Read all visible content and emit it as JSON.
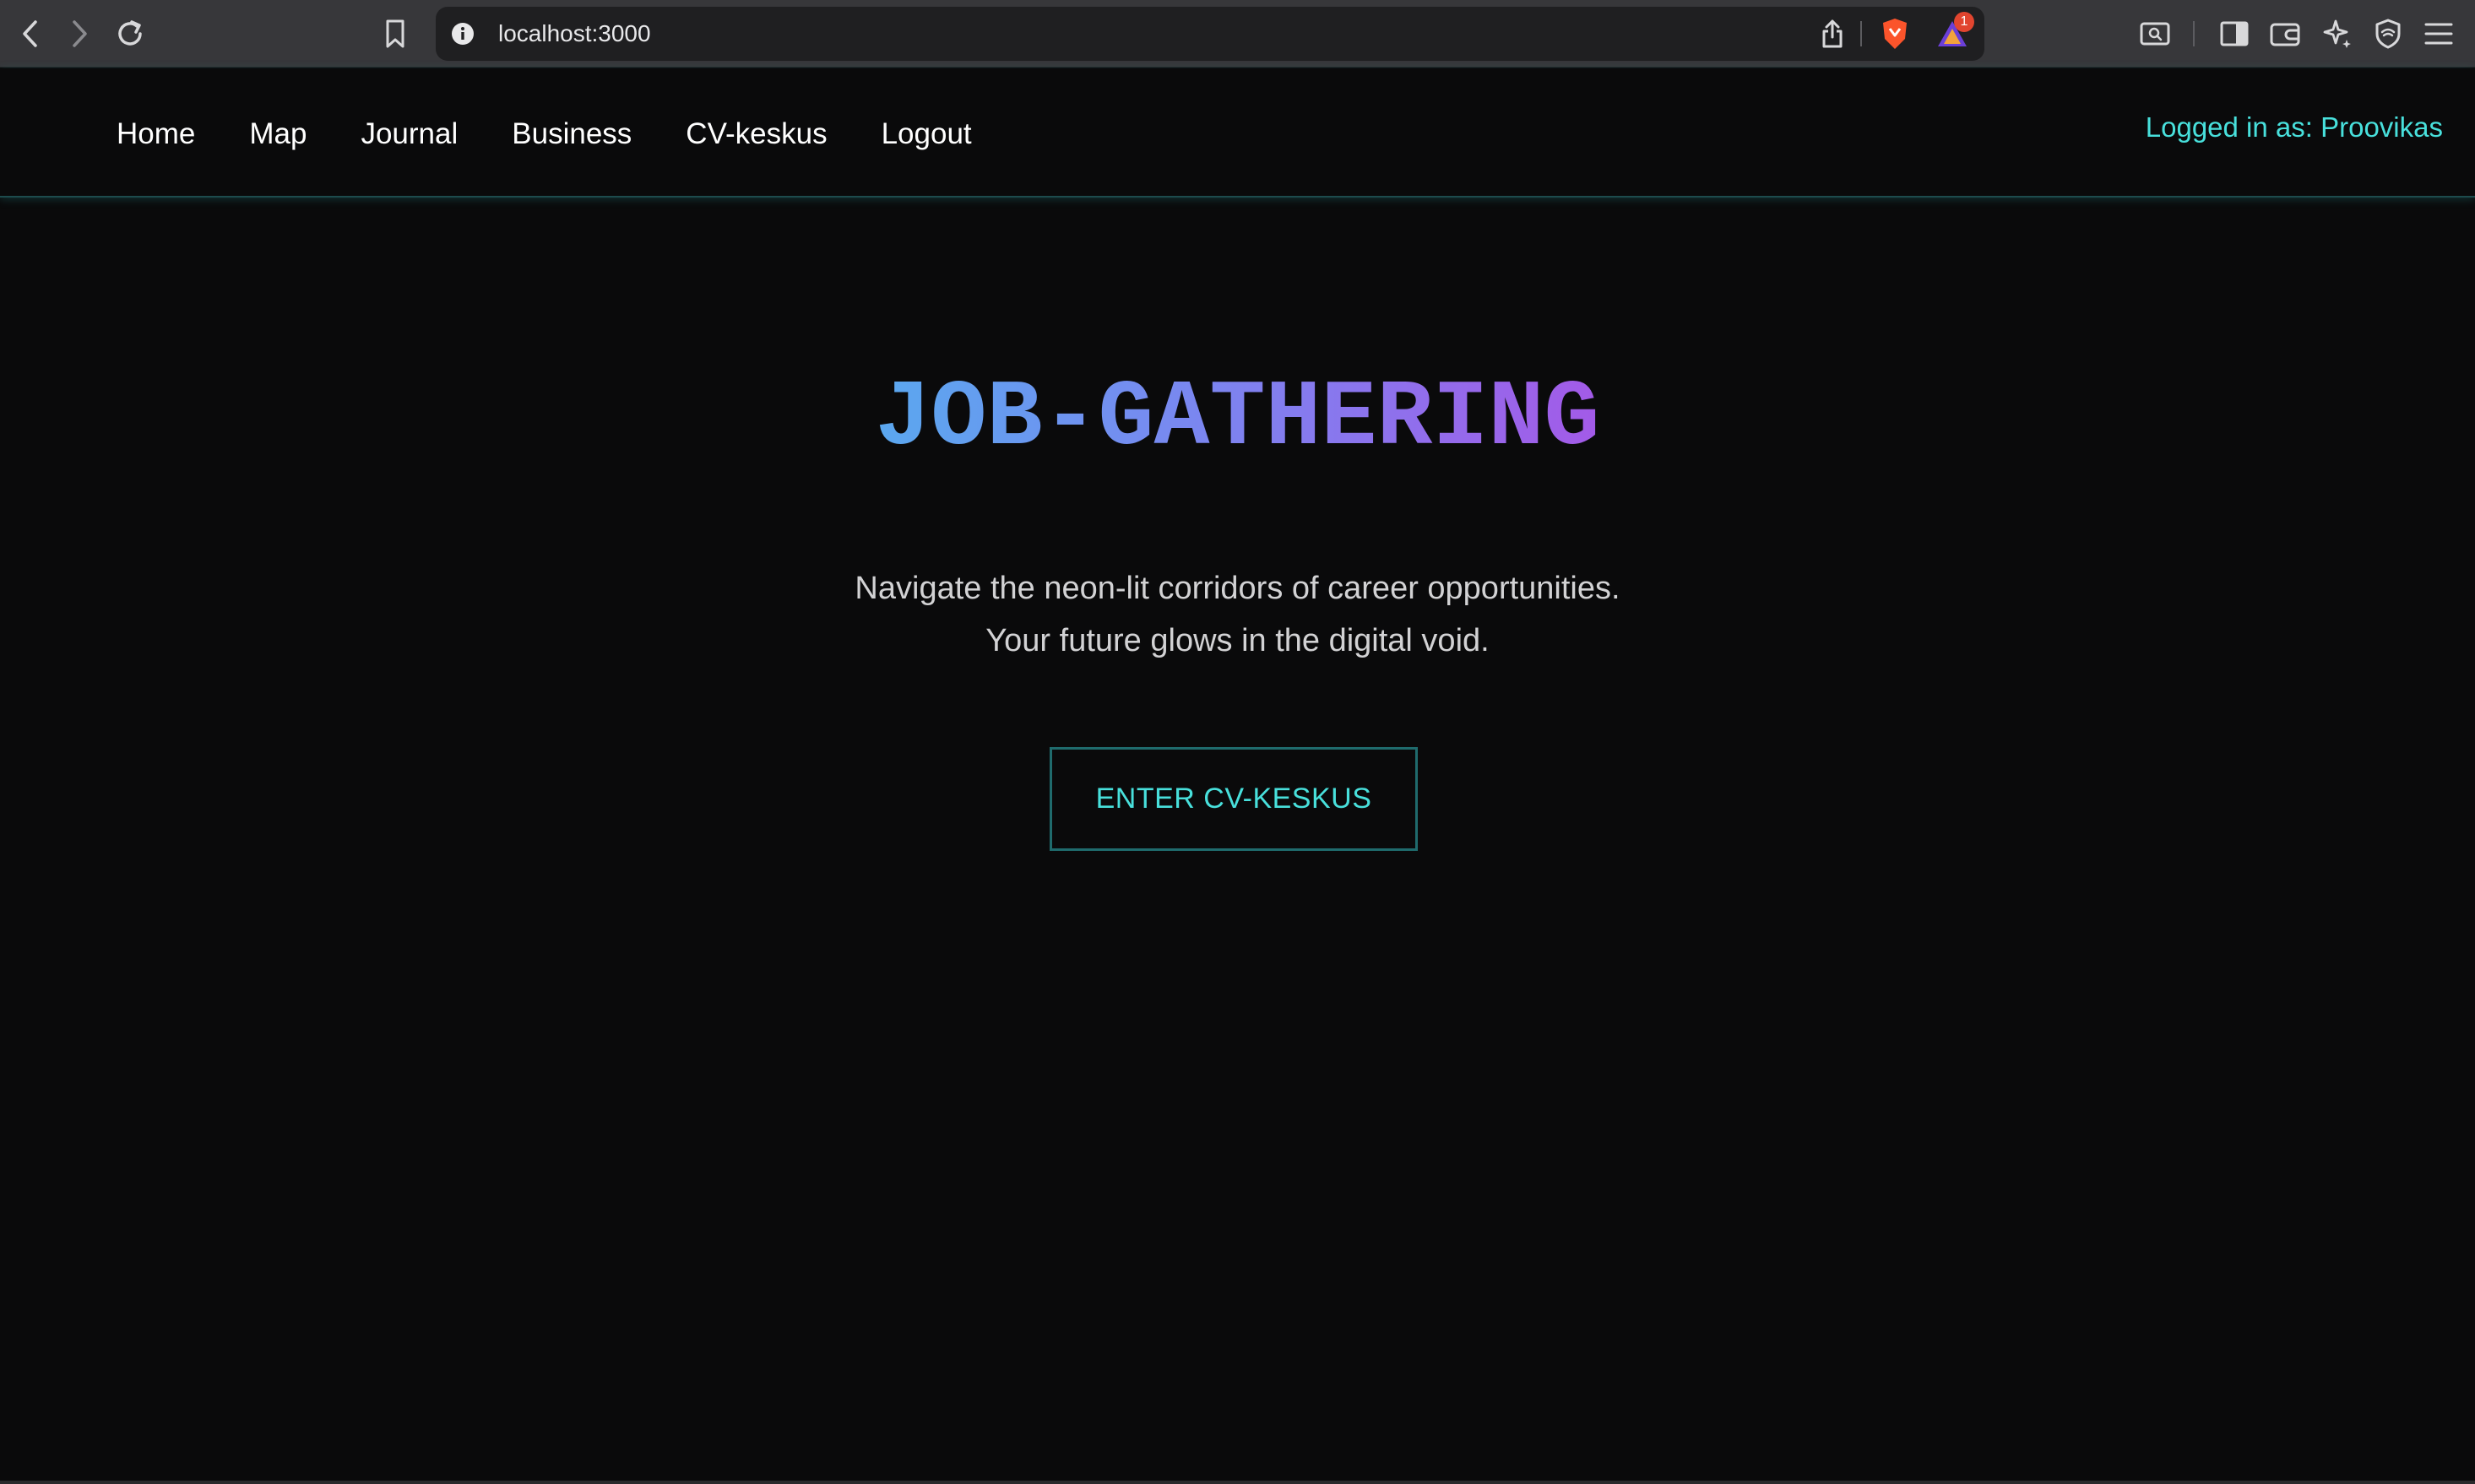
{
  "browser": {
    "url": "localhost:3000",
    "notification_count": "1",
    "icons": [
      "back-icon",
      "forward-icon",
      "reload-icon",
      "bookmark-icon",
      "site-info-icon",
      "share-icon",
      "brave-shields-icon",
      "brave-rewards-icon",
      "screenshot-search-icon",
      "sidebar-icon",
      "wallet-icon",
      "leo-ai-icon",
      "vpn-icon",
      "menu-icon"
    ]
  },
  "nav": {
    "links": [
      "Home",
      "Map",
      "Journal",
      "Business",
      "CV-keskus",
      "Logout"
    ],
    "logged_in": "Logged in as: Proovikas"
  },
  "hero": {
    "title": "JOB-GATHERING",
    "subtitle_line1": "Navigate the neon-lit corridors of career opportunities.",
    "subtitle_line2": "Your future glows in the digital void.",
    "cta_label": "ENTER CV-KESKUS"
  },
  "colors": {
    "background": "#0a0a0b",
    "accent_cyan": "#48e0dc",
    "title_gradient_start": "#5aa8ef",
    "title_gradient_end": "#a35ae8",
    "nav_border": "#1d4b4d"
  }
}
